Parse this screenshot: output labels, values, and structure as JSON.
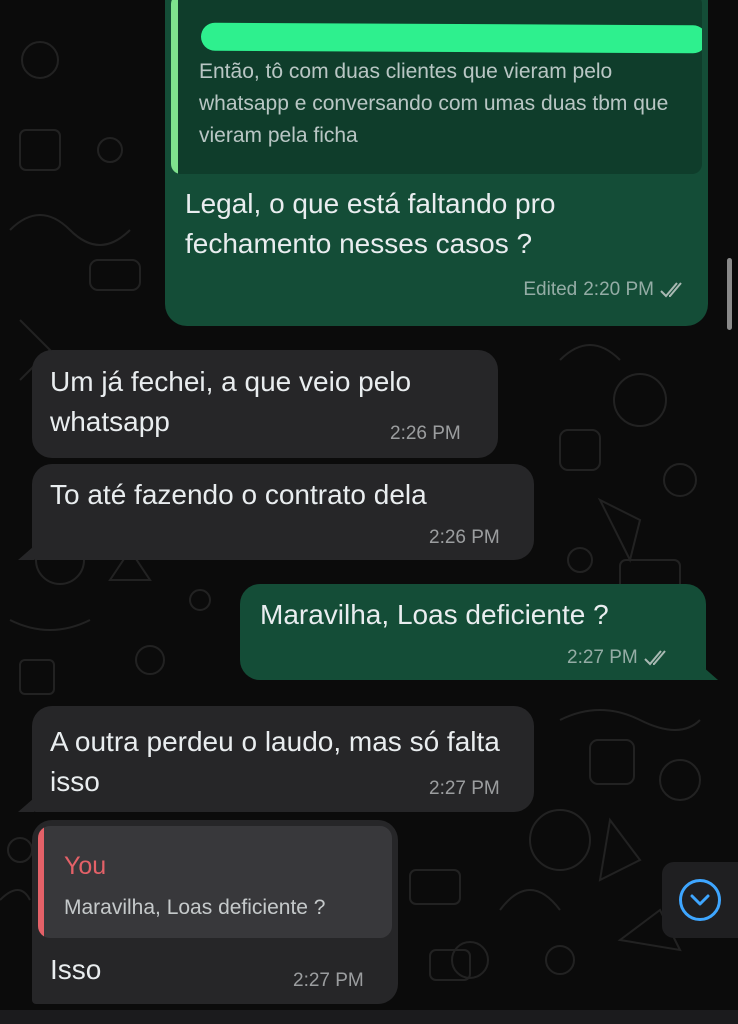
{
  "colors": {
    "outgoing_bubble": "#144d37",
    "incoming_bubble": "#262628",
    "quote_bar_outgoing": "#7fe28e",
    "quote_bar_incoming": "#e46168",
    "read_tick": "#a9b9b3",
    "accent_blue": "#3ea6ff"
  },
  "messages": [
    {
      "direction": "outgoing",
      "quote": {
        "author": "",
        "text": "Então, tô com duas clientes que vieram pelo whatsapp e conversando com umas duas tbm que vieram pela ficha"
      },
      "text": "Legal, o que está faltando pro fechamento nesses casos ?",
      "edited_label": "Edited",
      "time": "2:20 PM",
      "status": "read"
    },
    {
      "direction": "incoming",
      "text": "Um já fechei, a que veio pelo whatsapp",
      "time": "2:26 PM"
    },
    {
      "direction": "incoming",
      "text": "To até fazendo o contrato dela",
      "time": "2:26 PM"
    },
    {
      "direction": "outgoing",
      "text": "Maravilha, Loas deficiente ?",
      "time": "2:27 PM",
      "status": "read"
    },
    {
      "direction": "incoming",
      "text": "A outra perdeu o laudo, mas só falta isso",
      "time": "2:27 PM"
    },
    {
      "direction": "incoming",
      "quote": {
        "author": "You",
        "text": "Maravilha, Loas deficiente ?"
      },
      "text": "Isso",
      "time": "2:27 PM"
    }
  ],
  "scroll_button": {
    "icon": "chevron-down-icon"
  }
}
